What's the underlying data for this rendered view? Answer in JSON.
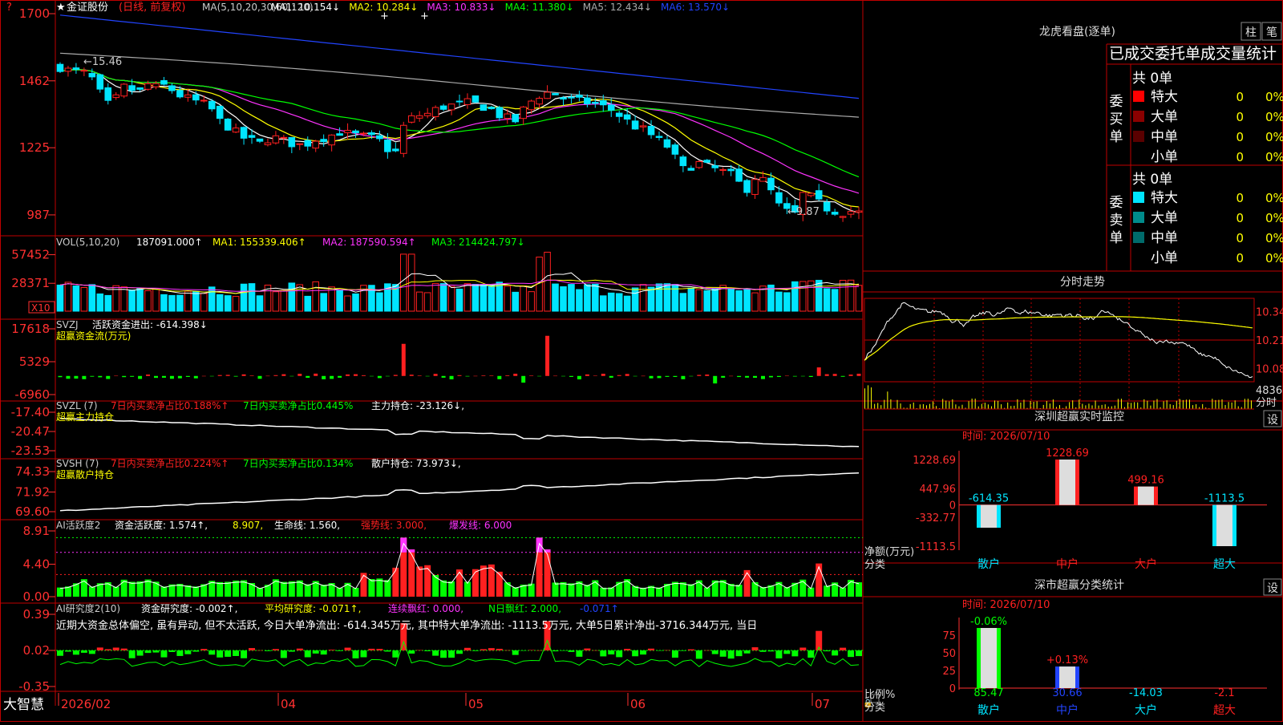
{
  "colors": {
    "up": "#ff2020",
    "down": "#00e5ff",
    "frame": "#c00000",
    "axis": "#ff3030",
    "green": "#00ff00",
    "white": "#ffffff",
    "yellow": "#ffff00",
    "magenta": "#ff33ff",
    "blue": "#2244ff",
    "gray": "#9a9a9a"
  },
  "icons": [
    "star-icon",
    "up-arrow-icon",
    "down-arrow-icon",
    "scroll-right-icon",
    "lock-icon"
  ],
  "header": {
    "stock_name": "金证股份",
    "period": "(日线, 前复权)",
    "ma_label": "MA(5,10,20,30,60,120)",
    "ma_values": [
      "MA1: 10.154",
      "MA2: 10.284",
      "MA3: 10.833",
      "MA4: 11.380",
      "MA5: 12.434",
      "MA6: 13.570"
    ],
    "ma_colors": [
      "#ffffff",
      "#ffff00",
      "#ff33ff",
      "#00ff00",
      "#aaaaaa",
      "#2244ff"
    ]
  },
  "main_panel": {
    "y_ticks": [
      "1700",
      "1462",
      "1225",
      "987"
    ],
    "high_label": "15.46",
    "low_label": "9.87"
  },
  "vol_panel": {
    "label": "VOL(5,10,20)",
    "value": "187091.000",
    "ma1": "MA1: 155339.406",
    "ma2": "MA2: 187590.594",
    "ma3": "MA3: 214424.797",
    "y_ticks": [
      "57452",
      "28371"
    ],
    "unit": "X10"
  },
  "svzj_panel": {
    "label": "SVZJ",
    "title": "活跃资金进出: -614.398",
    "subtitle": "超赢资金流(万元)",
    "y_ticks": [
      "17618",
      "5329",
      "-6960"
    ]
  },
  "svzl_panel": {
    "label": "SVZL (7)",
    "t1": "7日内买卖净占比0.188%",
    "t2": "7日内买卖净占比0.445%",
    "t3": "主力持仓: -23.126",
    "subtitle": "超赢主力持仓",
    "y_ticks": [
      "-17.40",
      "-20.47",
      "-23.53"
    ]
  },
  "svsh_panel": {
    "label": "SVSH (7)",
    "t1": "7日内买卖净占比0.224%",
    "t2": "7日内买卖净占比0.134%",
    "t3": "散户持仓: 73.973",
    "subtitle": "超赢散户持仓",
    "y_ticks": [
      "74.33",
      "71.92",
      "69.60"
    ]
  },
  "ai1_panel": {
    "label": "AI活跃度2",
    "t1": "资金活跃度: 1.574",
    "t2": "8.907",
    "t3": "生命线: 1.560",
    "t4": "强势线: 3.000",
    "t5": "爆发线: 6.000",
    "y_ticks": [
      "8.91",
      "4.40",
      "0.00"
    ]
  },
  "ai2_panel": {
    "label": "AI研究度2(10)",
    "t1": "资金研究度: -0.002",
    "t2": "平均研究度: -0.071",
    "t3": "连续飘红: 0.000",
    "t4": "N日飘红: 2.000",
    "t5": "-0.071",
    "comment": "近期大资金总体偏空, 虽有异动, 但不太活跃, 今日大单净流出: -614.345万元, 其中特大单净流出: -1113.5万元, 大单5日累计净出-3716.344万元, 当日",
    "y_ticks": [
      "0.39",
      "0.02",
      "-0.35"
    ]
  },
  "footer": {
    "brand": "大智慧",
    "dates": [
      "2026/02",
      "04",
      "05",
      "06",
      "07"
    ]
  },
  "lhb": {
    "title": "龙虎看盘(逐单)",
    "btn1": "柱",
    "btn2": "笔",
    "table_title": "已成交委托单成交量统计",
    "buy": {
      "side": "委买单",
      "total": "共 0单",
      "rows": [
        {
          "name": "特大",
          "count": "0",
          "pct": "0%",
          "color": "#ff0000"
        },
        {
          "name": "大单",
          "count": "0",
          "pct": "0%",
          "color": "#8b0000"
        },
        {
          "name": "中单",
          "count": "0",
          "pct": "0%",
          "color": "#5a0000"
        },
        {
          "name": "小单",
          "count": "0",
          "pct": "0%",
          "color": ""
        }
      ]
    },
    "sell": {
      "side": "委卖单",
      "total": "共 0单",
      "rows": [
        {
          "name": "特大",
          "count": "0",
          "pct": "0%",
          "color": "#00e5ff"
        },
        {
          "name": "大单",
          "count": "0",
          "pct": "0%",
          "color": "#008b8b"
        },
        {
          "name": "中单",
          "count": "0",
          "pct": "0%",
          "color": "#006b6b"
        },
        {
          "name": "小单",
          "count": "0",
          "pct": "0%",
          "color": ""
        }
      ]
    }
  },
  "intraday": {
    "title": "分时走势",
    "price_ticks": [
      "10.34",
      "10.21",
      "10.08"
    ],
    "vol_tick": "4836",
    "vol_unit": "分时"
  },
  "monitor": {
    "title": "深圳超赢实时监控",
    "btn": "设",
    "time_label": "时间: 2026/07/10",
    "y_ticks": [
      "1228.69",
      "447.96",
      "0",
      "-332.77",
      "-1113.5"
    ],
    "ylabel": "净额(万元)",
    "xlabel": "分类"
  },
  "classify": {
    "title": "深市超赢分类统计",
    "btn": "设",
    "time_label": "时间: 2026/07/10",
    "y_ticks": [
      "75",
      "50",
      "25",
      "0"
    ],
    "ylabel": "比例%",
    "xlabel": "分类"
  },
  "chart_data": [
    {
      "type": "candlestick",
      "title": "",
      "series": [
        {
          "name": "MA1"
        },
        {
          "name": "MA2"
        },
        {
          "name": "MA3"
        },
        {
          "name": "MA4"
        },
        {
          "name": "MA5"
        },
        {
          "name": "MA6"
        }
      ],
      "y_ticks": [
        1700,
        1462,
        1225,
        987
      ],
      "ylim": [
        930,
        1720
      ],
      "x_ticks": [
        "2026/02",
        "04",
        "05",
        "06",
        "07"
      ]
    },
    {
      "type": "bar",
      "title": "",
      "categories": [
        "散户",
        "中户",
        "大户",
        "超大"
      ],
      "values": [
        -614.35,
        1228.69,
        499.16,
        -1113.5
      ],
      "ylim": [
        -1113.5,
        1228.69
      ],
      "ylabel": "净额(万元)",
      "xlabel": "分类"
    },
    {
      "type": "bar",
      "title": "",
      "categories": [
        "散户",
        "中户",
        "大户",
        "超大"
      ],
      "values": [
        85.47,
        30.66,
        -14.03,
        -2.1
      ],
      "changes": [
        "-0.06%",
        "+0.13%",
        "",
        ""
      ],
      "ylim": [
        0,
        85.47
      ],
      "ylabel": "比例%",
      "xlabel": "分类"
    }
  ]
}
